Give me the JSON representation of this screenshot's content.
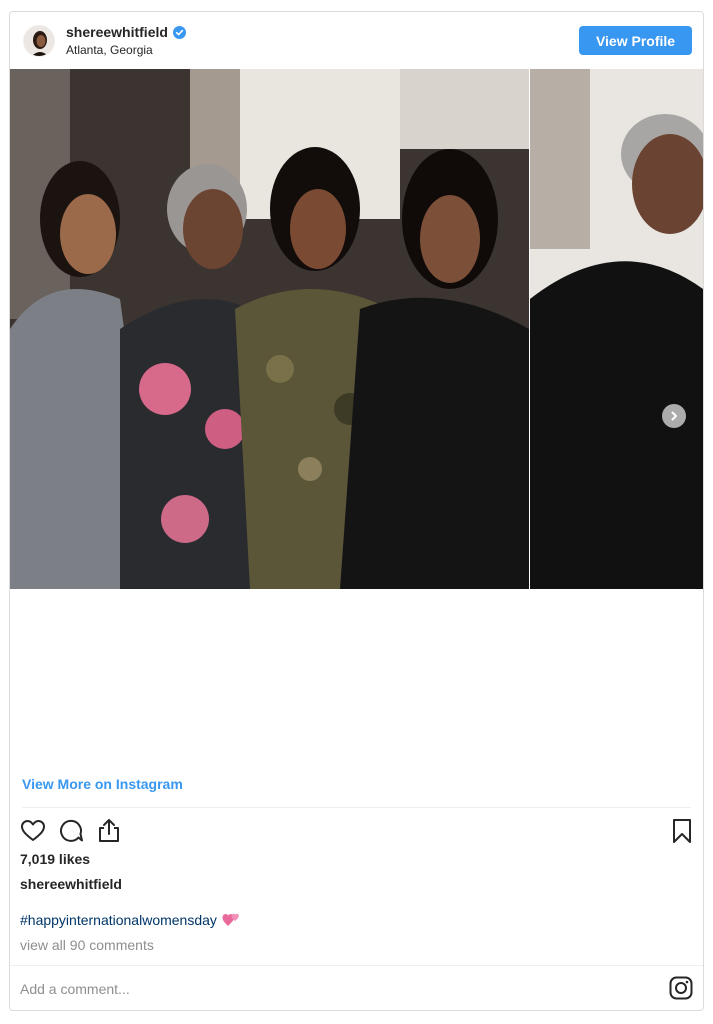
{
  "header": {
    "username": "shereewhitfield",
    "location": "Atlanta, Georgia",
    "view_profile_label": "View Profile",
    "verified_icon": "verified-badge-icon"
  },
  "post": {
    "view_more_label": "View More on Instagram",
    "likes": "7,019 likes",
    "caption_username": "shereewhitfield",
    "caption_text": "#happyinternationalwomensday",
    "caption_emoji": "two-hearts-icon",
    "view_comments": "view all 90 comments",
    "add_comment_placeholder": "Add a comment..."
  },
  "icons": {
    "like": "heart-outline-icon",
    "comment": "comment-bubble-icon",
    "share": "share-icon",
    "save": "bookmark-icon",
    "instagram": "instagram-logo-icon",
    "next": "chevron-right-icon"
  },
  "colors": {
    "accent": "#3897f0",
    "hashtag": "#003569",
    "muted": "#8e8e8e",
    "text": "#262626"
  }
}
